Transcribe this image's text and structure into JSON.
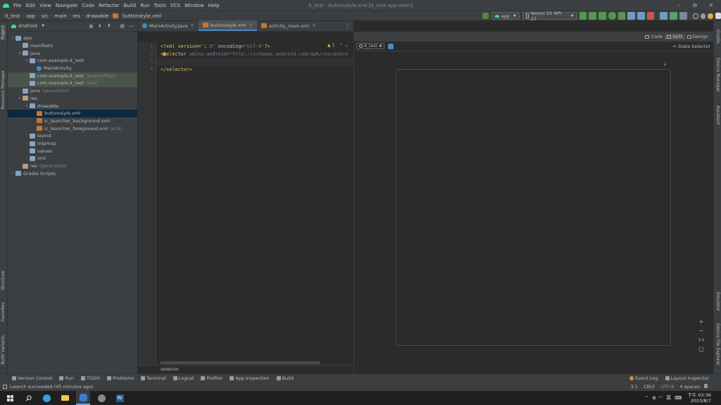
{
  "titlebar": {
    "menu": [
      "File",
      "Edit",
      "View",
      "Navigate",
      "Code",
      "Refactor",
      "Build",
      "Run",
      "Tools",
      "VCS",
      "Window",
      "Help"
    ],
    "title": "it_test - buttonstyle.xml [it_test.app.main]",
    "controls": [
      "–",
      "⧉",
      "✕"
    ]
  },
  "navbar": {
    "breadcrumbs": [
      "it_test",
      "app",
      "src",
      "main",
      "res",
      "drawable",
      "buttonstyle.xml"
    ],
    "run_config": "app",
    "device": "Nexus 5X API 27"
  },
  "left_strip": [
    "Project",
    "Resource Manager",
    "Structure",
    "Favorites",
    "Build Variants"
  ],
  "right_strip": [
    "Gradle",
    "Device Manager",
    "Assistant",
    "Emulator",
    "Device File Explorer"
  ],
  "project": {
    "view_selector": "Android",
    "tree": [
      {
        "indent": 0,
        "arrow": "∨",
        "icon": "folder",
        "label": "app",
        "suffix": ""
      },
      {
        "indent": 1,
        "arrow": "›",
        "icon": "folder",
        "label": "manifests",
        "suffix": ""
      },
      {
        "indent": 1,
        "arrow": "∨",
        "icon": "folder",
        "label": "java",
        "suffix": ""
      },
      {
        "indent": 2,
        "arrow": "∨",
        "icon": "pkg",
        "label": "com.example.it_test",
        "suffix": ""
      },
      {
        "indent": 3,
        "arrow": "",
        "icon": "cls",
        "label": "MainActivity",
        "suffix": ""
      },
      {
        "indent": 2,
        "arrow": "›",
        "icon": "pkg",
        "label": "com.example.it_test",
        "suffix": "(androidTest)",
        "test": true
      },
      {
        "indent": 2,
        "arrow": "›",
        "icon": "pkg",
        "label": "com.example.it_test",
        "suffix": "(test)",
        "test": true
      },
      {
        "indent": 1,
        "arrow": "›",
        "icon": "folder",
        "label": "java",
        "suffix": "(generated)"
      },
      {
        "indent": 1,
        "arrow": "∨",
        "icon": "resf",
        "label": "res",
        "suffix": ""
      },
      {
        "indent": 2,
        "arrow": "∨",
        "icon": "folder",
        "label": "drawable",
        "suffix": ""
      },
      {
        "indent": 3,
        "arrow": "",
        "icon": "xmlf",
        "label": "buttonstyle.xml",
        "suffix": "",
        "selected": true
      },
      {
        "indent": 3,
        "arrow": "",
        "icon": "xmlf",
        "label": "ic_launcher_background.xml",
        "suffix": ""
      },
      {
        "indent": 3,
        "arrow": "",
        "icon": "xmlf",
        "label": "ic_launcher_foreground.xml",
        "suffix": "(v24)"
      },
      {
        "indent": 2,
        "arrow": "›",
        "icon": "folder",
        "label": "layout",
        "suffix": ""
      },
      {
        "indent": 2,
        "arrow": "›",
        "icon": "folder",
        "label": "mipmap",
        "suffix": ""
      },
      {
        "indent": 2,
        "arrow": "›",
        "icon": "folder",
        "label": "values",
        "suffix": ""
      },
      {
        "indent": 2,
        "arrow": "›",
        "icon": "folder",
        "label": "xml",
        "suffix": ""
      },
      {
        "indent": 1,
        "arrow": "",
        "icon": "resf",
        "label": "res",
        "suffix": "(generated)"
      },
      {
        "indent": 0,
        "arrow": "›",
        "icon": "gradle",
        "label": "Gradle Scripts",
        "suffix": ""
      }
    ]
  },
  "tabs": [
    {
      "label": "MainActivity.java",
      "icon": "cls",
      "active": false
    },
    {
      "label": "buttonstyle.xml",
      "icon": "xmlf",
      "active": true
    },
    {
      "label": "activity_main.xml",
      "icon": "xmlf",
      "active": false
    }
  ],
  "editor": {
    "line_numbers": [
      "1",
      "2",
      "3",
      "4"
    ],
    "warning": "1",
    "lines": {
      "l1_a": "<?xml version=",
      "l1_b": "\"1.0\"",
      "l1_c": " encoding=",
      "l1_d": "\"utf-8\"",
      "l1_e": "?>",
      "l2_a": "<selector ",
      "l2_b": "xmlns:android=",
      "l2_c": "\"http://schemas.android.com/apk/res/andro",
      "l4": "</selector>"
    },
    "breadcrumb": "selector"
  },
  "preview": {
    "views": [
      "Code",
      "Split",
      "Design"
    ],
    "active_view": "Split",
    "theme": "it_test",
    "state_selector": "State Selector",
    "zoom_buttons": [
      "+",
      "−",
      "1:1",
      "▢"
    ]
  },
  "bottom_tools": [
    "Version Control",
    "Run",
    "TODO",
    "Problems",
    "Terminal",
    "Logcat",
    "Profiler",
    "App Inspection",
    "Build"
  ],
  "bottom_right_tools": [
    "Event Log",
    "Layout Inspector"
  ],
  "status": {
    "message": "Launch succeeded (45 minutes ago)",
    "position": "3:1",
    "line_sep": "CRLF",
    "encoding": "UTF-8",
    "indent": "4 spaces"
  },
  "taskbar": {
    "ime": "英",
    "time": "下午 03:36",
    "date": "2023/8/7"
  }
}
